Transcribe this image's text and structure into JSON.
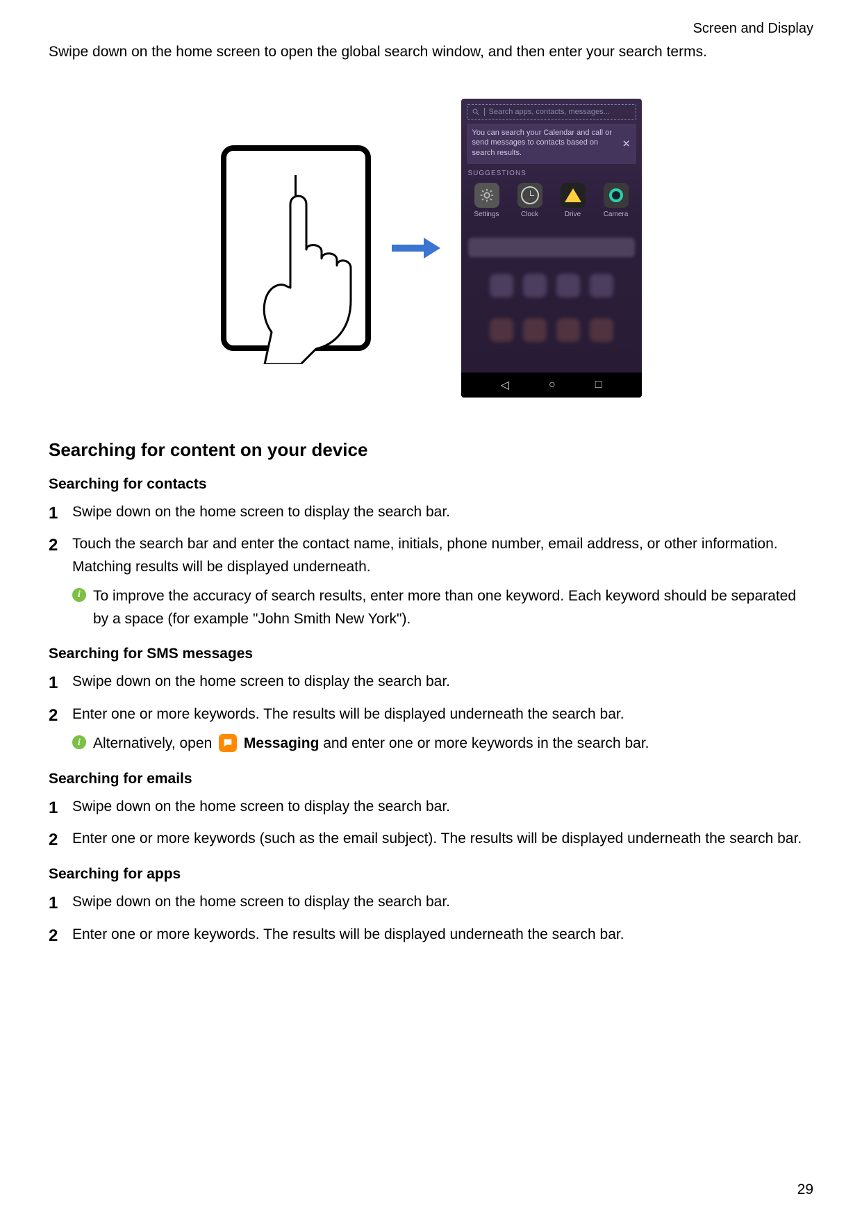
{
  "header": {
    "section": "Screen and Display"
  },
  "intro": "Swipe down on the home screen to open the global search window, and then enter your search terms.",
  "phone_mock": {
    "search_placeholder": "Search apps, contacts, messages...",
    "tip_text": "You can search your Calendar and call or send messages to contacts based on search results.",
    "suggestions_label": "SUGGESTIONS",
    "apps": [
      {
        "label": "Settings"
      },
      {
        "label": "Clock"
      },
      {
        "label": "Drive"
      },
      {
        "label": "Camera"
      }
    ],
    "nav": {
      "back": "◁",
      "home": "○",
      "recent": "□"
    }
  },
  "section_title": "Searching for content on your device",
  "contacts": {
    "heading": "Searching for contacts",
    "step1": "Swipe down on the home screen to display the search bar.",
    "step2": "Touch the search bar and enter the contact name, initials, phone number, email address, or other information. Matching results will be displayed underneath.",
    "tip": "To improve the accuracy of search results, enter more than one keyword. Each keyword should be separated by a space (for example \"John Smith New York\")."
  },
  "sms": {
    "heading": "Searching for SMS messages",
    "step1": "Swipe down on the home screen to display the search bar.",
    "step2": "Enter one or more keywords. The results will be displayed underneath the search bar.",
    "tip_pre": "Alternatively, open ",
    "tip_app": "Messaging",
    "tip_post": " and enter one or more keywords in the search bar."
  },
  "emails": {
    "heading": "Searching for emails",
    "step1": "Swipe down on the home screen to display the search bar.",
    "step2": "Enter one or more keywords (such as the email subject). The results will be displayed underneath the search bar."
  },
  "apps": {
    "heading": "Searching for apps",
    "step1": "Swipe down on the home screen to display the search bar.",
    "step2": "Enter one or more keywords. The results will be displayed underneath the search bar."
  },
  "page_number": "29"
}
